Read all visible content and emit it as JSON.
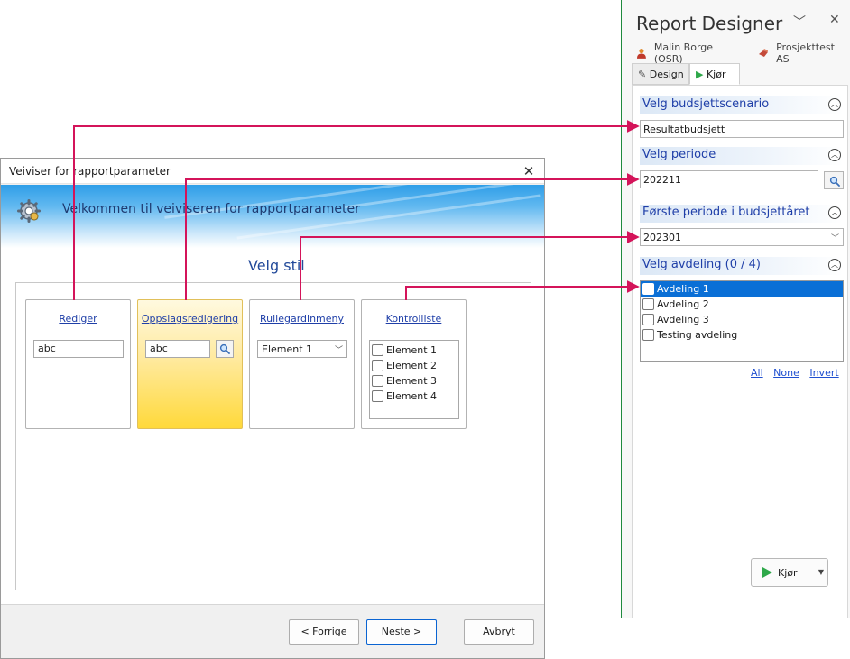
{
  "wizard": {
    "title": "Veiviser for rapportparameter",
    "close_glyph": "✕",
    "banner_text": "Velkommen til veiviseren for rapportparameter",
    "heading": "Velg stil",
    "cards": [
      {
        "label": "Rediger",
        "value": "abc"
      },
      {
        "label": "Oppslagsredigering",
        "value": "abc"
      },
      {
        "label": "Rullegardinmeny",
        "value": "Element 1"
      },
      {
        "label": "Kontrolliste",
        "items": [
          "Element 1",
          "Element 2",
          "Element 3",
          "Element 4"
        ]
      }
    ],
    "buttons": {
      "back": "< Forrige",
      "next": "Neste >",
      "cancel": "Avbryt"
    }
  },
  "designer": {
    "title": "Report Designer",
    "user": "Malin Borge (OSR)",
    "project": "Prosjekttest AS",
    "tabs": [
      "Design",
      "Kjør"
    ],
    "sections": {
      "scenario": {
        "title": "Velg budsjettscenario",
        "value": "Resultatbudsjett"
      },
      "period": {
        "title": "Velg periode",
        "value": "202211"
      },
      "first_period": {
        "title": "Første periode i budsjettåret",
        "value": "202301"
      },
      "department": {
        "title": "Velg avdeling (0 / 4)",
        "items": [
          "Avdeling 1",
          "Avdeling 2",
          "Avdeling 3",
          "Testing avdeling"
        ]
      }
    },
    "links": {
      "all": "All",
      "none": "None",
      "invert": "Invert"
    },
    "run_label": "Kjør"
  },
  "colors": {
    "arrow": "#d4145a",
    "accent": "#0a6fd6",
    "run_icon": "#2ea84a"
  }
}
